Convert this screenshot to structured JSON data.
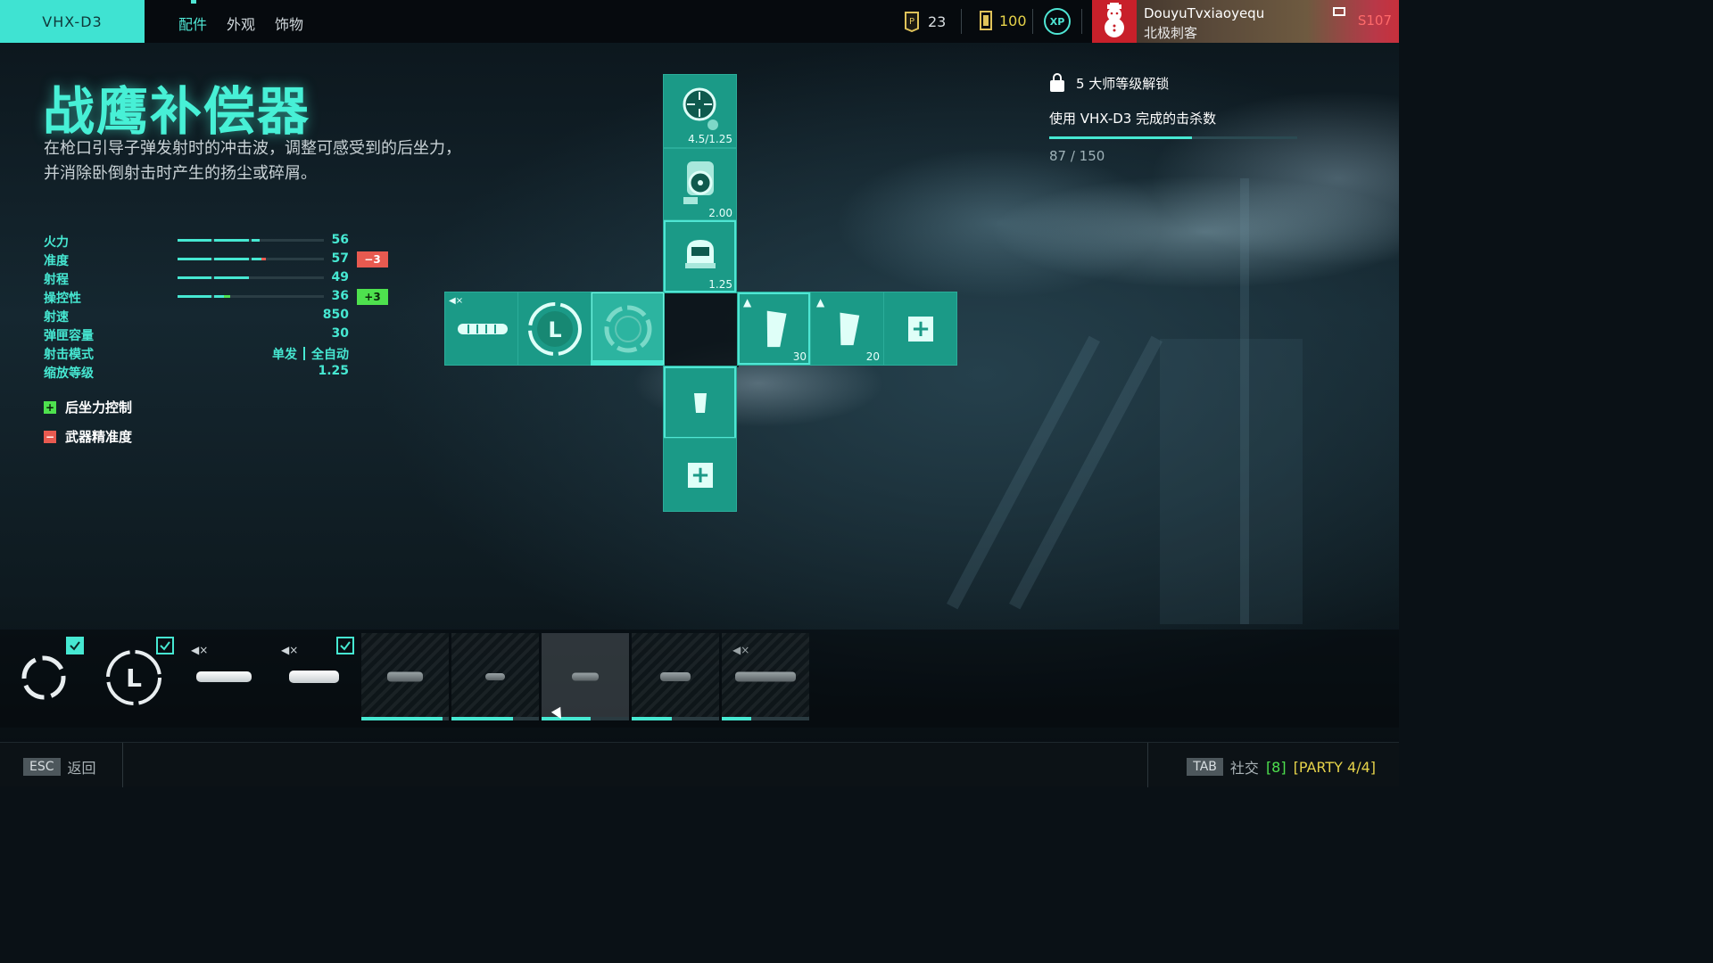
{
  "topbar": {
    "weapon_name": "VHX-D3",
    "tabs": [
      {
        "label": "配件",
        "active": true
      },
      {
        "label": "外观",
        "active": false
      },
      {
        "label": "饰物",
        "active": false
      }
    ],
    "currency_coins": "23",
    "currency_bonds": "100",
    "xp_label": "XP",
    "player_name": "DouyuTvxiaoyequ",
    "player_title": "北极刺客",
    "server": "S107"
  },
  "attachment": {
    "name": "战鹰补偿器",
    "description": "在枪口引导子弹发射时的冲击波，调整可感受到的后坐力，并消除卧倒射击时产生的扬尘或碎屑。"
  },
  "stats": [
    {
      "label": "火力",
      "value": "56",
      "fill": 0.56
    },
    {
      "label": "准度",
      "value": "57",
      "fill": 0.57,
      "delta": "−3",
      "delta_type": "neg"
    },
    {
      "label": "射程",
      "value": "49",
      "fill": 0.49
    },
    {
      "label": "操控性",
      "value": "36",
      "fill": 0.36,
      "delta": "+3",
      "delta_type": "pos"
    },
    {
      "label": "射速",
      "value": "850"
    },
    {
      "label": "弹匣容量",
      "value": "30"
    },
    {
      "label": "射击模式",
      "fire_modes": [
        "单发",
        "全自动"
      ]
    },
    {
      "label": "缩放等级",
      "value": "1.25"
    }
  ],
  "pros_cons": {
    "pro_label": "后坐力控制",
    "con_label": "武器精准度"
  },
  "unlock": {
    "header": "5 大师等级解锁",
    "task": "使用 VHX-D3 完成的击杀数",
    "progress_text": "87 / 150",
    "progress": 0.58
  },
  "loadout_grid": {
    "optic_1_zoom": "4.5/1.25",
    "optic_2_zoom": "2.00",
    "optic_3_zoom": "1.25",
    "mag_1_count": "30",
    "mag_2_count": "20"
  },
  "carousel_progress": [
    0.93,
    0.7,
    0.56,
    0.46,
    0.34
  ],
  "footer": {
    "esc_key": "ESC",
    "back_label": "返回",
    "tab_key": "TAB",
    "social_label": "社交",
    "social_count": "[8]",
    "party_label": "[PARTY 4/4]"
  },
  "colors": {
    "accent": "#46e8d2",
    "tile": "#1b9a87",
    "positive": "#4ee14e",
    "negative": "#e85a50"
  }
}
